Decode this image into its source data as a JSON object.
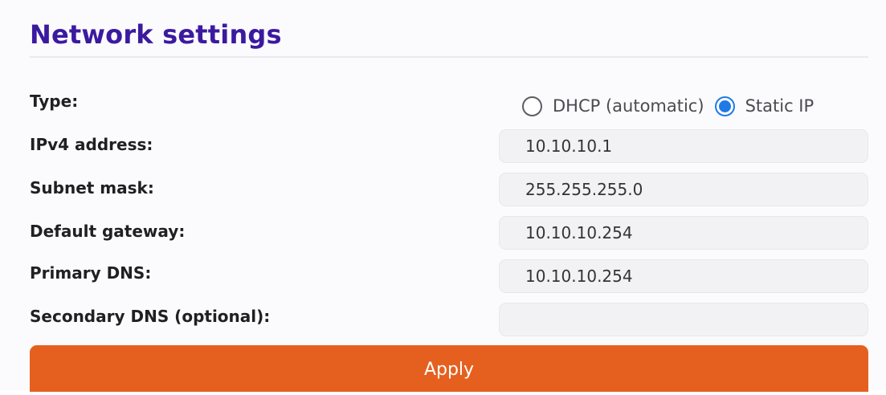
{
  "page": {
    "title": "Network settings"
  },
  "type": {
    "label": "Type:",
    "options": [
      {
        "label": "DHCP (automatic)",
        "checked": false
      },
      {
        "label": "Static IP",
        "checked": true
      }
    ]
  },
  "fields": {
    "ipv4": {
      "label": "IPv4 address:",
      "value": "10.10.10.1"
    },
    "subnet": {
      "label": "Subnet mask:",
      "value": "255.255.255.0"
    },
    "gateway": {
      "label": "Default gateway:",
      "value": "10.10.10.254"
    },
    "primary_dns": {
      "label": "Primary DNS:",
      "value": "10.10.10.254"
    },
    "secondary_dns": {
      "label": "Secondary DNS (optional):",
      "value": ""
    }
  },
  "apply_label": "Apply",
  "colors": {
    "title": "#3b1aa0",
    "radio_checked": "#1f7ae6",
    "apply_button": "#e5601e"
  }
}
